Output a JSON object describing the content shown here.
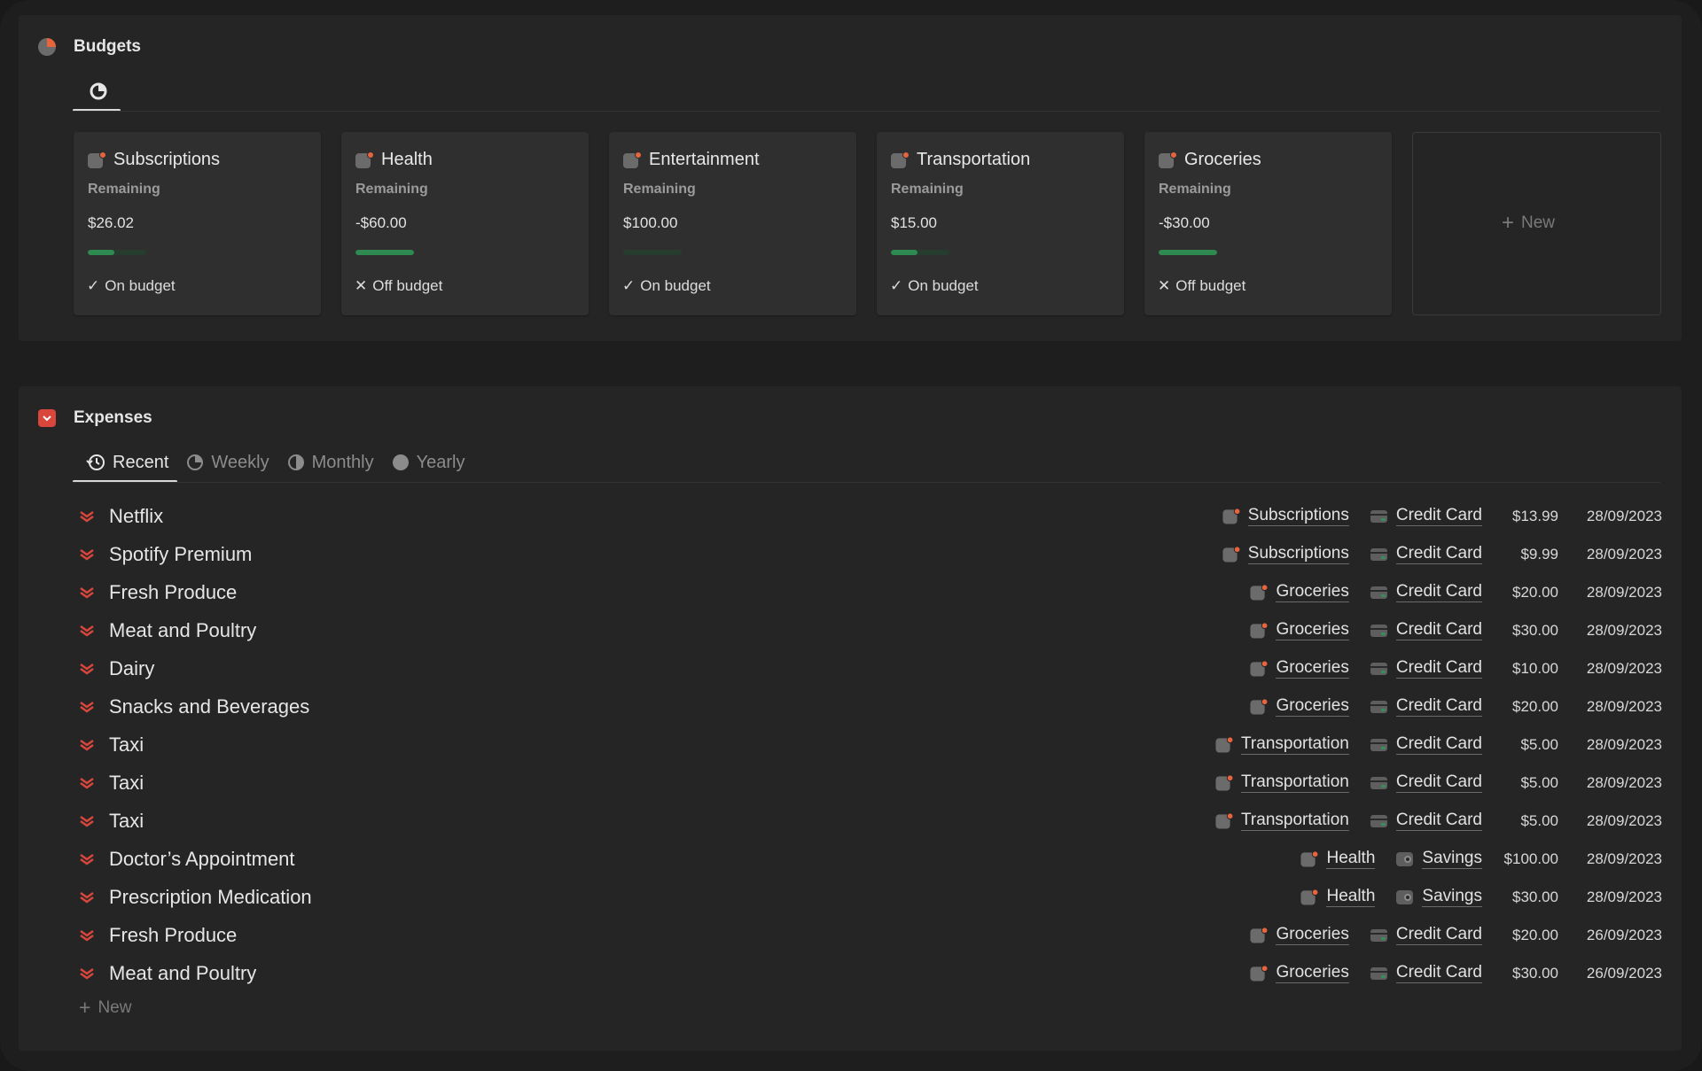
{
  "budgets": {
    "title": "Budgets",
    "cards": [
      {
        "title": "Subscriptions",
        "label": "Remaining",
        "value": "$26.02",
        "progress": 0.45,
        "status_icon": "check-icon",
        "status": "On budget"
      },
      {
        "title": "Health",
        "label": "Remaining",
        "value": "-$60.00",
        "progress": 1.0,
        "status_icon": "x-icon",
        "status": "Off budget"
      },
      {
        "title": "Entertainment",
        "label": "Remaining",
        "value": "$100.00",
        "progress": 0.0,
        "status_icon": "check-icon",
        "status": "On budget"
      },
      {
        "title": "Transportation",
        "label": "Remaining",
        "value": "$15.00",
        "progress": 0.45,
        "status_icon": "check-icon",
        "status": "On budget"
      },
      {
        "title": "Groceries",
        "label": "Remaining",
        "value": "-$30.00",
        "progress": 1.0,
        "status_icon": "x-icon",
        "status": "Off budget"
      }
    ],
    "new_label": "New"
  },
  "expenses": {
    "title": "Expenses",
    "tabs": [
      {
        "label": "Recent",
        "icon": "history-icon",
        "active": true
      },
      {
        "label": "Weekly",
        "icon": "pie-quarter-icon",
        "active": false
      },
      {
        "label": "Monthly",
        "icon": "half-circle-icon",
        "active": false
      },
      {
        "label": "Yearly",
        "icon": "full-circle-icon",
        "active": false
      }
    ],
    "rows": [
      {
        "name": "Netflix",
        "category": "Subscriptions",
        "account": "Credit Card",
        "account_icon": "credit-card-icon",
        "amount": "$13.99",
        "date": "28/09/2023"
      },
      {
        "name": "Spotify Premium",
        "category": "Subscriptions",
        "account": "Credit Card",
        "account_icon": "credit-card-icon",
        "amount": "$9.99",
        "date": "28/09/2023"
      },
      {
        "name": "Fresh Produce",
        "category": "Groceries",
        "account": "Credit Card",
        "account_icon": "credit-card-icon",
        "amount": "$20.00",
        "date": "28/09/2023"
      },
      {
        "name": "Meat and Poultry",
        "category": "Groceries",
        "account": "Credit Card",
        "account_icon": "credit-card-icon",
        "amount": "$30.00",
        "date": "28/09/2023"
      },
      {
        "name": "Dairy",
        "category": "Groceries",
        "account": "Credit Card",
        "account_icon": "credit-card-icon",
        "amount": "$10.00",
        "date": "28/09/2023"
      },
      {
        "name": "Snacks and Beverages",
        "category": "Groceries",
        "account": "Credit Card",
        "account_icon": "credit-card-icon",
        "amount": "$20.00",
        "date": "28/09/2023"
      },
      {
        "name": "Taxi",
        "category": "Transportation",
        "account": "Credit Card",
        "account_icon": "credit-card-icon",
        "amount": "$5.00",
        "date": "28/09/2023"
      },
      {
        "name": "Taxi",
        "category": "Transportation",
        "account": "Credit Card",
        "account_icon": "credit-card-icon",
        "amount": "$5.00",
        "date": "28/09/2023"
      },
      {
        "name": "Taxi",
        "category": "Transportation",
        "account": "Credit Card",
        "account_icon": "credit-card-icon",
        "amount": "$5.00",
        "date": "28/09/2023"
      },
      {
        "name": "Doctor’s Appointment",
        "category": "Health",
        "account": "Savings",
        "account_icon": "wallet-icon",
        "amount": "$100.00",
        "date": "28/09/2023"
      },
      {
        "name": "Prescription Medication",
        "category": "Health",
        "account": "Savings",
        "account_icon": "wallet-icon",
        "amount": "$30.00",
        "date": "28/09/2023"
      },
      {
        "name": "Fresh Produce",
        "category": "Groceries",
        "account": "Credit Card",
        "account_icon": "credit-card-icon",
        "amount": "$20.00",
        "date": "26/09/2023"
      },
      {
        "name": "Meat and Poultry",
        "category": "Groceries",
        "account": "Credit Card",
        "account_icon": "credit-card-icon",
        "amount": "$30.00",
        "date": "26/09/2023"
      }
    ],
    "new_label": "New"
  },
  "colors": {
    "accent_orange": "#e8643c",
    "expense_red": "#d9463c",
    "progress_green": "#2f8a52",
    "background": "#191919",
    "panel": "#252525",
    "card": "#2f2f2f"
  }
}
